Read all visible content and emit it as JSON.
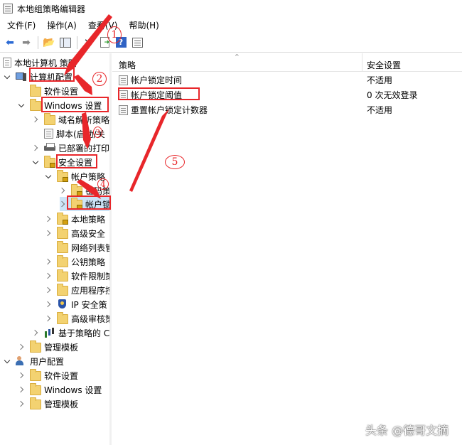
{
  "window": {
    "title": "本地组策略编辑器"
  },
  "menu": {
    "file": "文件(F)",
    "action": "操作(A)",
    "view": "查看(V)",
    "help": "帮助(H)"
  },
  "tree": {
    "root": "本地计算机 策略",
    "computer_config": "计算机配置",
    "software_settings": "软件设置",
    "windows_settings": "Windows 设置",
    "dns_policy": "域名解析策略",
    "scripts": "脚本(启动/关",
    "deployed_printers": "已部署的打印",
    "security_settings": "安全设置",
    "account_policies": "帐户策略",
    "password_policy": "密码策",
    "account_lockout": "帐户锁",
    "local_policies": "本地策略",
    "advanced_security": "高级安全",
    "network_list": "网络列表管",
    "public_key": "公钥策略",
    "software_restriction": "软件限制策",
    "app_control": "应用程序控",
    "ip_security": "IP 安全策",
    "advanced_audit": "高级审核策",
    "qos": "基于策略的 C",
    "admin_templates": "管理模板",
    "user_config": "用户配置",
    "user_software_settings": "软件设置",
    "user_windows_settings": "Windows 设置",
    "user_admin_templates": "管理模板"
  },
  "list": {
    "headers": {
      "policy": "策略",
      "setting": "安全设置"
    },
    "rows": [
      {
        "policy": "帐户锁定时间",
        "setting": "不适用"
      },
      {
        "policy": "帐户锁定阈值",
        "setting": "0 次无效登录"
      },
      {
        "policy": "重置帐户锁定计数器",
        "setting": "不适用"
      }
    ]
  },
  "annotations": {
    "n1": "1",
    "n2": "2",
    "n3": "3",
    "n4": "4",
    "n5": "5"
  },
  "watermark": "头条 @德哥文摘"
}
